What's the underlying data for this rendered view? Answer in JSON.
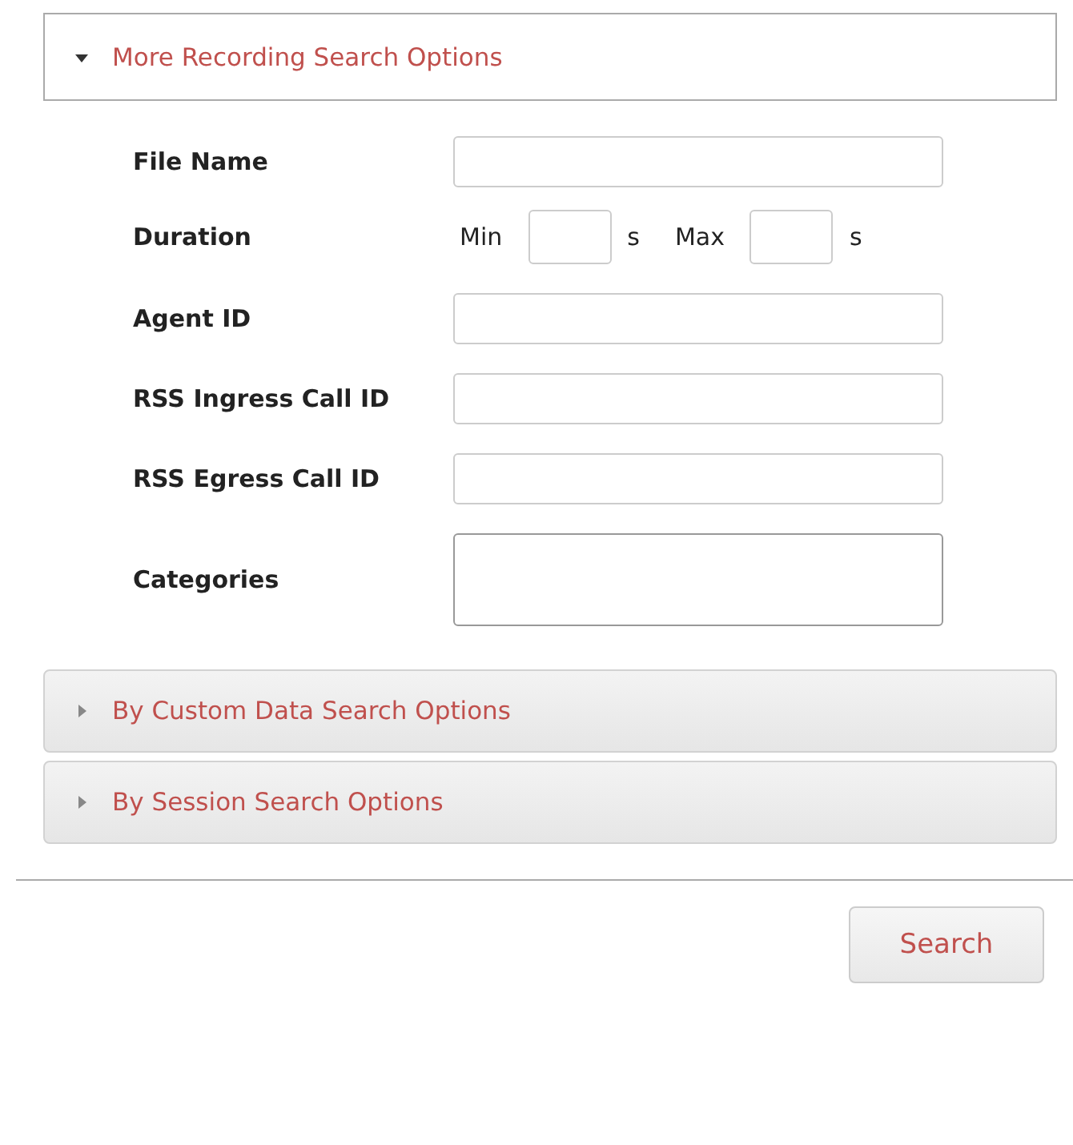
{
  "panels": [
    {
      "title": "More Recording Search Options",
      "expanded": true,
      "fields": [
        {
          "kind": "text",
          "label": "File Name"
        },
        {
          "kind": "duration",
          "label": "Duration",
          "min_label": "Min",
          "min_unit": "s",
          "max_label": "Max",
          "max_unit": "s"
        },
        {
          "kind": "text",
          "label": "Agent ID"
        },
        {
          "kind": "text",
          "label": "RSS Ingress Call ID"
        },
        {
          "kind": "text",
          "label": "RSS Egress Call ID"
        },
        {
          "kind": "list",
          "label": "Categories"
        }
      ]
    },
    {
      "title": "By Custom Data Search Options",
      "expanded": false
    },
    {
      "title": "By Session Search Options",
      "expanded": false
    }
  ],
  "search_button": "Search"
}
